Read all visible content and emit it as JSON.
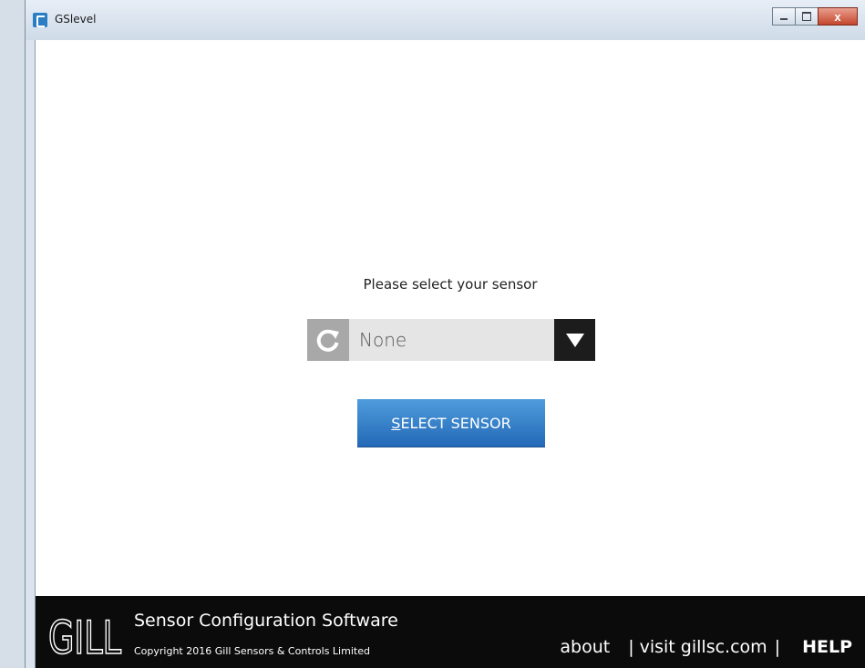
{
  "window": {
    "title": "GSlevel",
    "controls": {
      "minimize_icon": "minimize-icon",
      "maximize_icon": "maximize-icon",
      "close_label": "x"
    }
  },
  "main": {
    "prompt": "Please select your sensor",
    "sensor_select": {
      "value": "None",
      "refresh_icon": "refresh-icon",
      "arrow_icon": "triangle-down-icon"
    },
    "select_button": {
      "mnemonic": "S",
      "label_rest": "ELECT SENSOR"
    }
  },
  "footer": {
    "logo_text": "GILL",
    "app_name": "Sensor Configuration Software",
    "copyright": "Copyright 2016 Gill Sensors & Controls Limited",
    "links": {
      "about": "about",
      "visit": "visit gillsc.com",
      "help": "HELP",
      "separator": "|"
    }
  },
  "colors": {
    "accent": "#2f7bc9",
    "footer_bg": "#0b0b0b",
    "dropdown_bg": "#e5e5e5"
  }
}
